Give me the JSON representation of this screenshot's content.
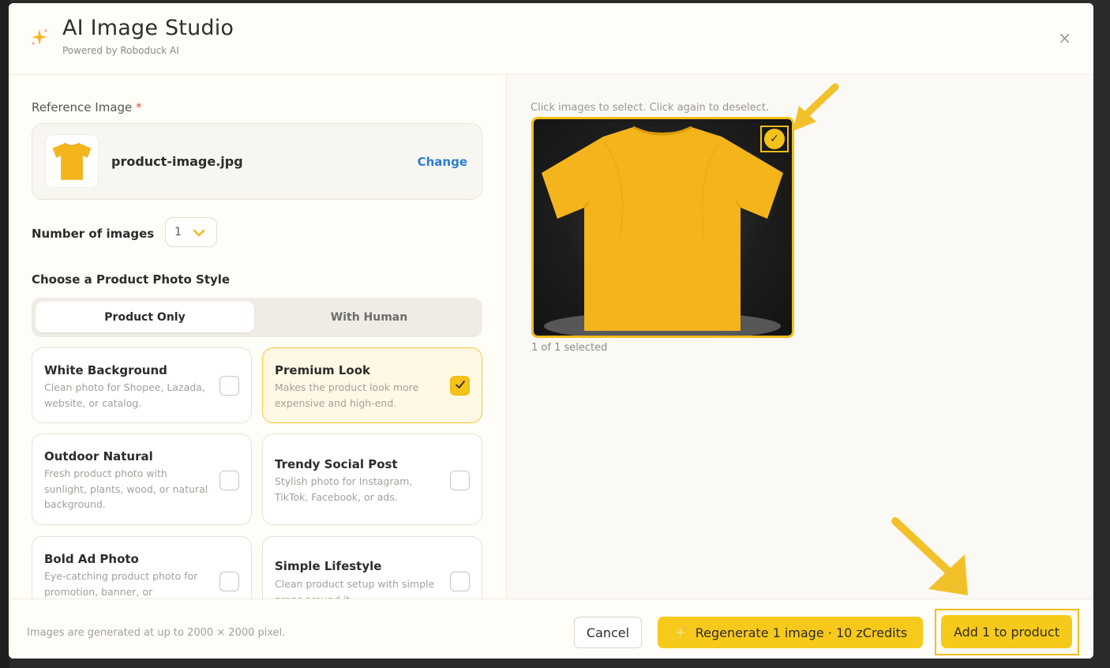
{
  "header": {
    "title": "AI Image Studio",
    "subtitle": "Powered by Roboduck AI",
    "close_glyph": "×"
  },
  "reference": {
    "label": "Reference Image",
    "required_mark": "*",
    "file_name": "product-image.jpg",
    "change_label": "Change"
  },
  "number_of_images": {
    "label": "Number of images",
    "value": "1"
  },
  "style_section": {
    "label": "Choose a Product Photo Style",
    "tabs": [
      {
        "label": "Product Only",
        "active": true
      },
      {
        "label": "With Human",
        "active": false
      }
    ],
    "options": [
      {
        "title": "White Background",
        "desc": "Clean photo for Shopee, Lazada, website, or catalog.",
        "selected": false
      },
      {
        "title": "Premium Look",
        "desc": "Makes the product look more expensive and high-end.",
        "selected": true
      },
      {
        "title": "Outdoor Natural",
        "desc": "Fresh product photo with sunlight, plants, wood, or natural background.",
        "selected": false
      },
      {
        "title": "Trendy Social Post",
        "desc": "Stylish photo for Instagram, TikTok, Facebook, or ads.",
        "selected": false
      },
      {
        "title": "Bold Ad Photo",
        "desc": "Eye-catching product photo for promotion, banner, or",
        "selected": false
      },
      {
        "title": "Simple Lifestyle",
        "desc": "Clean product setup with simple props around it.",
        "selected": false
      }
    ]
  },
  "results": {
    "hint": "Click images to select. Click again to deselect.",
    "selected_text": "1 of 1 selected",
    "check_glyph": "✓"
  },
  "footer": {
    "note": "Images are generated at up to 2000 × 2000 pixel.",
    "cancel_label": "Cancel",
    "regenerate_label": "Regenerate 1 image · 10 zCredits",
    "add_label": "Add 1 to product"
  },
  "colors": {
    "accent": "#f7c91a",
    "link": "#2a7fd4",
    "shirt": "#f4b41c"
  },
  "icons": [
    "sparkle-icon",
    "close-icon",
    "chevron-down-icon",
    "check-icon",
    "tshirt-icon"
  ]
}
